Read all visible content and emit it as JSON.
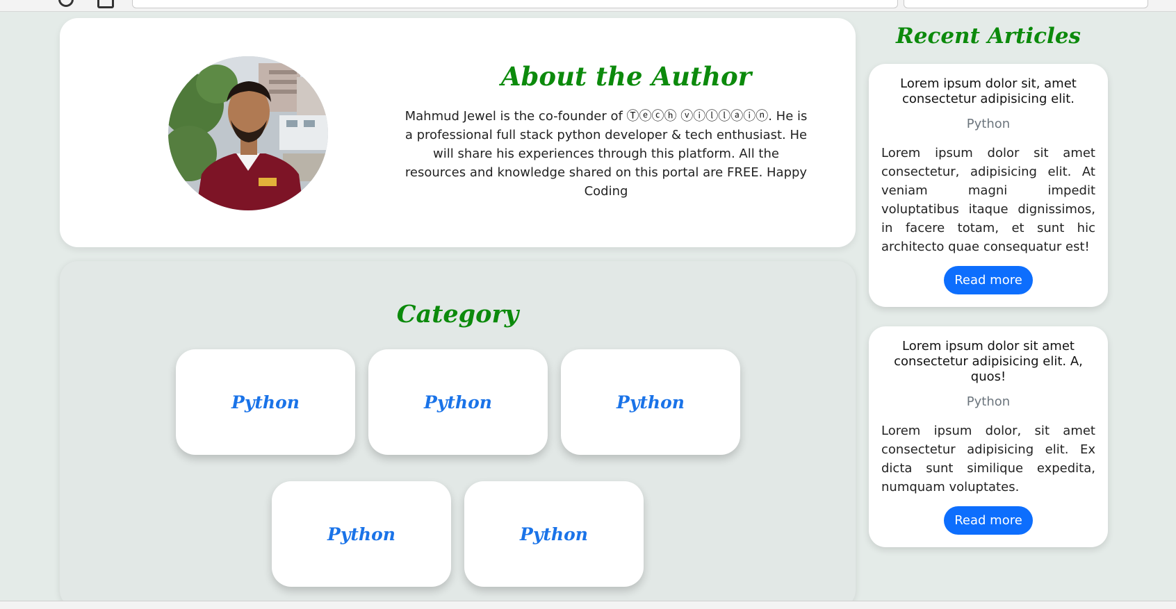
{
  "browser": {
    "url_text": "                                                                   "
  },
  "about": {
    "title": "About the Author",
    "text": "Mahmud Jewel is the co-founder of Ⓣⓔⓒⓗ ⓥⓘⓛⓛⓐⓘⓝ. He is a professional full stack python developer & tech enthusiast. He will share his experiences through this platform. All the resources and knowledge shared on this portal are FREE. Happy Coding",
    "avatar_icon": "author-photo"
  },
  "category": {
    "title": "Category",
    "items": [
      {
        "label": "Python"
      },
      {
        "label": "Python"
      },
      {
        "label": "Python"
      },
      {
        "label": "Python"
      },
      {
        "label": "Python"
      }
    ]
  },
  "recent": {
    "title": "Recent Articles",
    "articles": [
      {
        "title": "Lorem ipsum dolor sit, amet consectetur adipisicing elit.",
        "category": "Python",
        "excerpt": "Lorem ipsum dolor sit amet consectetur, adipisicing elit. At veniam magni impedit voluptatibus itaque dignissimos, in facere totam, et sunt hic architecto quae consequatur est!",
        "button": "Read more"
      },
      {
        "title": "Lorem ipsum dolor sit amet consectetur adipisicing elit. A, quos!",
        "category": "Python",
        "excerpt": "Lorem ipsum dolor, sit amet consectetur adipisicing elit. Ex dicta sunt similique expedita, numquam voluptates.",
        "button": "Read more"
      }
    ]
  },
  "colors": {
    "page_bg": "#e4ebe8",
    "heading_green": "#0c8a0c",
    "link_blue": "#1a73e8",
    "button_blue": "#0d6efd"
  }
}
